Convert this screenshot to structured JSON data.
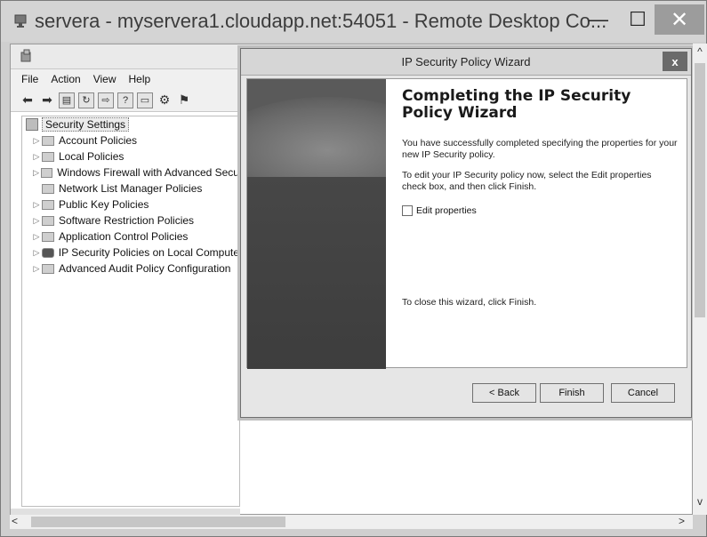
{
  "rdp": {
    "title": "servera - myservera1.cloudapp.net:54051 - Remote Desktop Co...",
    "minimize_glyph": "—",
    "maximize_glyph": "☐",
    "close_glyph": "✕"
  },
  "mmc": {
    "menu": [
      "File",
      "Action",
      "View",
      "Help"
    ],
    "toolbar_icons": [
      "back-arrow-icon",
      "forward-arrow-icon",
      "show-hide-tree-icon",
      "refresh-icon",
      "export-icon",
      "help-icon",
      "properties-icon",
      "manage-filters-icon",
      "assign-icon"
    ],
    "tree_root": "Security Settings",
    "tree_items": [
      {
        "label": "Account Policies",
        "expandable": true
      },
      {
        "label": "Local Policies",
        "expandable": true
      },
      {
        "label": "Windows Firewall with Advanced Secu",
        "expandable": true
      },
      {
        "label": "Network List Manager Policies",
        "expandable": false
      },
      {
        "label": "Public Key Policies",
        "expandable": true
      },
      {
        "label": "Software Restriction Policies",
        "expandable": true
      },
      {
        "label": "Application Control Policies",
        "expandable": true
      },
      {
        "label": "IP Security Policies on Local Compute",
        "expandable": true
      },
      {
        "label": "Advanced Audit Policy Configuration",
        "expandable": true
      }
    ]
  },
  "wizard": {
    "title": "IP Security Policy Wizard",
    "close_glyph": "x",
    "heading": "Completing the IP Security Policy Wizard",
    "paragraph1": "You have successfully completed specifying the properties for your new IP Security policy.",
    "paragraph2": "To edit your IP Security policy now, select the Edit properties check box, and then click Finish.",
    "checkbox_label": "Edit properties",
    "checkbox_checked": false,
    "closing_text": "To close this wizard, click Finish.",
    "back_label": "< Back",
    "finish_label": "Finish",
    "cancel_label": "Cancel"
  },
  "scroll": {
    "up_glyph": "^",
    "down_glyph": "v",
    "left_glyph": "<",
    "right_glyph": ">"
  }
}
